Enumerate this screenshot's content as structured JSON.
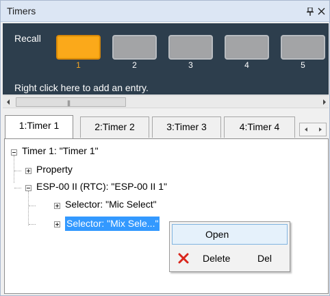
{
  "window": {
    "title": "Timers"
  },
  "recall": {
    "label": "Recall",
    "slots": [
      {
        "number": "1",
        "active": true
      },
      {
        "number": "2",
        "active": false
      },
      {
        "number": "3",
        "active": false
      },
      {
        "number": "4",
        "active": false
      },
      {
        "number": "5",
        "active": false
      }
    ],
    "hint": "Right click here to add an entry.",
    "colors": {
      "panel": "#2d3e4d",
      "active_slot": "#f7a814",
      "inactive_slot": "#a3a4a6"
    }
  },
  "tabs": [
    {
      "label": "1:Timer 1",
      "selected": true
    },
    {
      "label": "2:Timer 2",
      "selected": false
    },
    {
      "label": "3:Timer 3",
      "selected": false
    },
    {
      "label": "4:Timer 4",
      "selected": false
    }
  ],
  "tree": {
    "root": "Timer 1: \"Timer 1\"",
    "property": "Property",
    "device": "ESP-00 II (RTC): \"ESP-00 II 1\"",
    "selector_mic": "Selector: \"Mic Select\"",
    "selector_mix": "Selector: \"Mix Sele...\""
  },
  "context_menu": {
    "open": "Open",
    "delete": "Delete",
    "delete_shortcut": "Del",
    "delete_icon": "red-x-icon"
  },
  "icons": {
    "pin": "pin-icon",
    "close": "close-icon",
    "scroll_left": "chevron-left-icon",
    "scroll_right": "chevron-right-icon"
  }
}
